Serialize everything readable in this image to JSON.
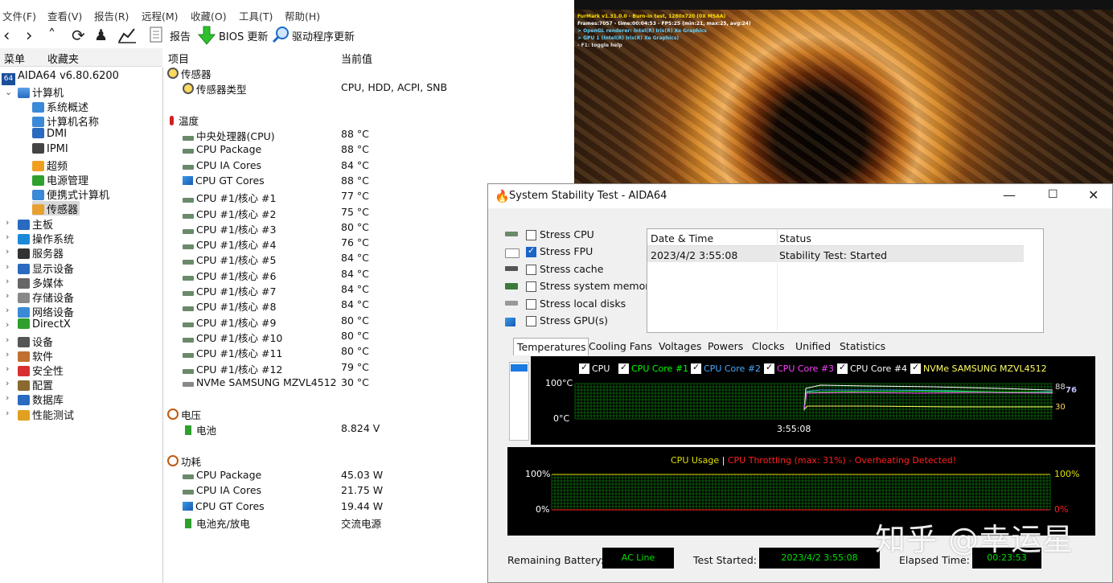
{
  "menu": [
    "文件(F)",
    "查看(V)",
    "报告(R)",
    "远程(M)",
    "收藏(O)",
    "工具(T)",
    "帮助(H)"
  ],
  "toolbar": {
    "report": "报告",
    "bios": "BIOS 更新",
    "driver": "驱动程序更新"
  },
  "left_tabs": [
    "菜单",
    "收藏夹"
  ],
  "tree": {
    "root": "AIDA64 v6.80.6200",
    "computer": "计算机",
    "computer_children": [
      "系统概述",
      "计算机名称",
      "DMI",
      "IPMI",
      "超频",
      "电源管理",
      "便携式计算机",
      "传感器"
    ],
    "others": [
      "主板",
      "操作系统",
      "服务器",
      "显示设备",
      "多媒体",
      "存储设备",
      "网络设备",
      "DirectX",
      "设备",
      "软件",
      "安全性",
      "配置",
      "数据库",
      "性能测试"
    ]
  },
  "columns": {
    "item": "项目",
    "value": "当前值"
  },
  "sensors": {
    "section_sensor": "传感器",
    "sensor_type": {
      "name": "传感器类型",
      "value": "CPU, HDD, ACPI, SNB"
    },
    "section_temp": "温度",
    "temps": [
      {
        "name": "中央处理器(CPU)",
        "value": "88 °C"
      },
      {
        "name": "CPU Package",
        "value": "88 °C"
      },
      {
        "name": "CPU IA Cores",
        "value": "84 °C"
      },
      {
        "name": "CPU GT Cores",
        "value": "88 °C"
      },
      {
        "name": "CPU #1/核心 #1",
        "value": "77 °C"
      },
      {
        "name": "CPU #1/核心 #2",
        "value": "75 °C"
      },
      {
        "name": "CPU #1/核心 #3",
        "value": "80 °C"
      },
      {
        "name": "CPU #1/核心 #4",
        "value": "76 °C"
      },
      {
        "name": "CPU #1/核心 #5",
        "value": "84 °C"
      },
      {
        "name": "CPU #1/核心 #6",
        "value": "84 °C"
      },
      {
        "name": "CPU #1/核心 #7",
        "value": "84 °C"
      },
      {
        "name": "CPU #1/核心 #8",
        "value": "84 °C"
      },
      {
        "name": "CPU #1/核心 #9",
        "value": "80 °C"
      },
      {
        "name": "CPU #1/核心 #10",
        "value": "80 °C"
      },
      {
        "name": "CPU #1/核心 #11",
        "value": "80 °C"
      },
      {
        "name": "CPU #1/核心 #12",
        "value": "79 °C"
      },
      {
        "name": "NVMe SAMSUNG MZVL4512",
        "value": "30 °C"
      }
    ],
    "section_voltage": "电压",
    "voltages": [
      {
        "name": "电池",
        "value": "8.824 V"
      }
    ],
    "section_power": "功耗",
    "powers": [
      {
        "name": "CPU Package",
        "value": "45.03 W"
      },
      {
        "name": "CPU IA Cores",
        "value": "21.75 W"
      },
      {
        "name": "CPU GT Cores",
        "value": "19.44 W"
      },
      {
        "name": "电池充/放电",
        "value": "交流电源"
      }
    ]
  },
  "furmark": {
    "lines": [
      "FurMark v1.31.0.0 - Burn-in test, 1280x720 (0X MSAA)",
      "Frames:7057 - time:00:04:53 - FPS:25 (min:21, max:25, avg:24)",
      "> OpenGL renderer: Intel(R) Iris(R) Xe Graphics",
      "> GPU 1 (Intel(R) Iris(R) Xe Graphics)",
      "- F1: toggle help"
    ]
  },
  "stability": {
    "title": "System Stability Test - AIDA64",
    "stress": [
      {
        "label": "Stress CPU",
        "checked": false
      },
      {
        "label": "Stress FPU",
        "checked": true
      },
      {
        "label": "Stress cache",
        "checked": false
      },
      {
        "label": "Stress system memory",
        "checked": false
      },
      {
        "label": "Stress local disks",
        "checked": false
      },
      {
        "label": "Stress GPU(s)",
        "checked": false
      }
    ],
    "log_headers": {
      "datetime": "Date & Time",
      "status": "Status"
    },
    "log_rows": [
      {
        "datetime": "2023/4/2 3:55:08",
        "status": "Stability Test: Started"
      }
    ],
    "tabs": [
      "Temperatures",
      "Cooling Fans",
      "Voltages",
      "Powers",
      "Clocks",
      "Unified",
      "Statistics"
    ],
    "temp_legend": [
      "CPU",
      "CPU Core #1",
      "CPU Core #2",
      "CPU Core #3",
      "CPU Core #4",
      "NVMe SAMSUNG MZVL4512"
    ],
    "temp_legend_colors": [
      "#ffffff",
      "#00ff00",
      "#4aa8ff",
      "#ff40ff",
      "#ffffff",
      "#ffff60"
    ],
    "temp_axis": {
      "top": "100°C",
      "bottom": "0°C",
      "time": "3:55:08"
    },
    "temp_readout": {
      "a": "88",
      "b": "76",
      "c": "30"
    },
    "usage_title_a": "CPU Usage",
    "usage_sep": "|",
    "usage_title_b": "CPU Throttling (max: 31%) - Overheating Detected!",
    "usage_axis": {
      "top_left": "100%",
      "bottom_left": "0%",
      "top_right": "100%",
      "bottom_right": "0%"
    },
    "bottom": {
      "battery_label": "Remaining Battery:",
      "battery_value": "AC Line",
      "started_label": "Test Started:",
      "started_value": "2023/4/2 3:55:08",
      "elapsed_label": "Elapsed Time:",
      "elapsed_value": "00:23:53"
    }
  },
  "watermark": "知乎 @幸运星"
}
